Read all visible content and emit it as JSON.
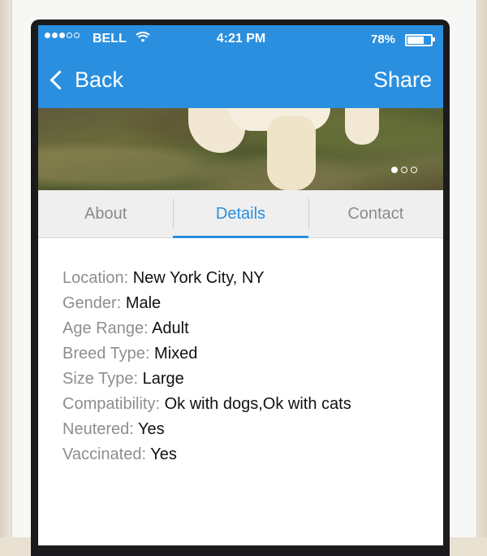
{
  "status_bar": {
    "carrier": "BELL",
    "time": "4:21 PM",
    "battery_percent": "78%",
    "battery_level": 0.78,
    "signal_strength": 3
  },
  "nav": {
    "back_label": "Back",
    "share_label": "Share"
  },
  "gallery": {
    "page_count": 3,
    "active_page": 1
  },
  "tabs": [
    {
      "label": "About",
      "active": false
    },
    {
      "label": "Details",
      "active": true
    },
    {
      "label": "Contact",
      "active": false
    }
  ],
  "details": [
    {
      "label": "Location:",
      "value": "New York City, NY"
    },
    {
      "label": "Gender:",
      "value": "Male"
    },
    {
      "label": "Age Range:",
      "value": "Adult"
    },
    {
      "label": "Breed Type:",
      "value": "Mixed"
    },
    {
      "label": "Size Type:",
      "value": "Large"
    },
    {
      "label": "Compatibility:",
      "value": "Ok with dogs,Ok with cats"
    },
    {
      "label": "Neutered:",
      "value": "Yes"
    },
    {
      "label": "Vaccinated:",
      "value": "Yes"
    }
  ],
  "colors": {
    "accent": "#2a8fdf",
    "label_gray": "#8e8e8e"
  }
}
